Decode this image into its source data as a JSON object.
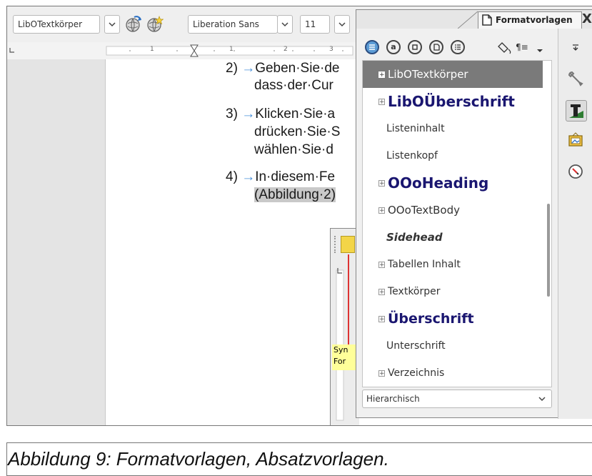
{
  "toolbar": {
    "paragraph_style": "LibOTextkörper",
    "font_name": "Liberation Sans",
    "font_size": "11"
  },
  "ruler": {
    "ticks": [
      "1",
      "1",
      "2",
      "3"
    ]
  },
  "document": {
    "lines": [
      {
        "num": "2)",
        "text": "Geben·Sie·de"
      },
      {
        "text": "dass·der·Cur"
      },
      {
        "num": "3)",
        "text": "Klicken·Sie·a"
      },
      {
        "text": "drücken·Sie·S"
      },
      {
        "text": "wählen·Sie·d"
      },
      {
        "num": "4)",
        "text": "In·diesem·Fe"
      },
      {
        "text": "(Abbildung·2)"
      }
    ],
    "inset_label_1": "Syn",
    "inset_label_2": "For"
  },
  "sidebar": {
    "deck_title": "Formatvorlagen",
    "close_glyph": "X",
    "styles": [
      {
        "label": "LibOTextkörper",
        "expandable": true,
        "selected": true,
        "style": "body"
      },
      {
        "label": "LibOÜberschrift",
        "expandable": true,
        "style": "heading"
      },
      {
        "label": "Listeninhalt",
        "expandable": false,
        "style": "small"
      },
      {
        "label": "Listenkopf",
        "expandable": false,
        "style": "small"
      },
      {
        "label": "OOoHeading",
        "expandable": true,
        "style": "heading"
      },
      {
        "label": "OOoTextBody",
        "expandable": true,
        "style": "body"
      },
      {
        "label": "Sidehead",
        "expandable": false,
        "style": "sidehead"
      },
      {
        "label": "Tabellen Inhalt",
        "expandable": true,
        "style": "body-small"
      },
      {
        "label": "Textkörper",
        "expandable": true,
        "style": "body-small"
      },
      {
        "label": "Überschrift",
        "expandable": true,
        "style": "heading-sm"
      },
      {
        "label": "Unterschrift",
        "expandable": false,
        "style": "small"
      },
      {
        "label": "Verzeichnis",
        "expandable": true,
        "style": "body-small"
      }
    ],
    "filter": "Hierarchisch"
  },
  "caption": "Abbildung 9: Formatvorlagen, Absatzvorlagen.",
  "colors": {
    "heading_blue": "#1a1670",
    "selected_bg": "#7a7a7a",
    "arrow": "#4a90d9"
  },
  "icons": {
    "update-style": "globe-arrow-icon",
    "new-style": "globe-star-icon",
    "deck-properties": "wrench-icon",
    "deck-styles": "T-style-icon",
    "deck-gallery": "gallery-icon",
    "deck-navigator": "compass-icon"
  }
}
